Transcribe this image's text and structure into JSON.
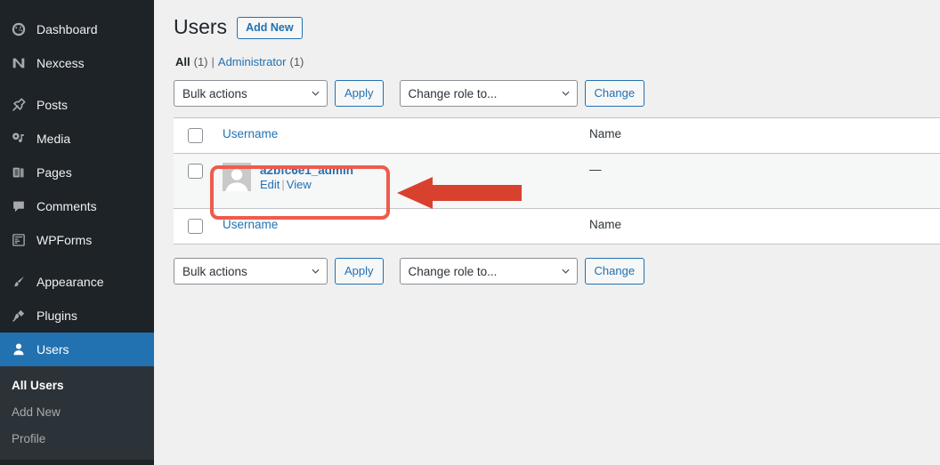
{
  "sidebar": {
    "items": [
      {
        "label": "Dashboard",
        "icon": "dashboard-icon",
        "name": "sidebar-item-dashboard",
        "active": false
      },
      {
        "label": "Nexcess",
        "icon": "nexcess-icon",
        "name": "sidebar-item-nexcess",
        "active": false
      },
      {
        "label": "Posts",
        "icon": "pushpin-icon",
        "name": "sidebar-item-posts",
        "active": false
      },
      {
        "label": "Media",
        "icon": "media-icon",
        "name": "sidebar-item-media",
        "active": false
      },
      {
        "label": "Pages",
        "icon": "pages-icon",
        "name": "sidebar-item-pages",
        "active": false
      },
      {
        "label": "Comments",
        "icon": "comment-icon",
        "name": "sidebar-item-comments",
        "active": false
      },
      {
        "label": "WPForms",
        "icon": "wpforms-icon",
        "name": "sidebar-item-wpforms",
        "active": false
      },
      {
        "label": "Appearance",
        "icon": "paintbrush-icon",
        "name": "sidebar-item-appearance",
        "active": false
      },
      {
        "label": "Plugins",
        "icon": "plug-icon",
        "name": "sidebar-item-plugins",
        "active": false
      },
      {
        "label": "Users",
        "icon": "user-icon",
        "name": "sidebar-item-users",
        "active": true
      }
    ],
    "submenu": [
      {
        "label": "All Users",
        "current": true
      },
      {
        "label": "Add New",
        "current": false
      },
      {
        "label": "Profile",
        "current": false
      }
    ],
    "active_color": "#2271b1",
    "background": "#1d2327",
    "submenu_background": "#2c3338"
  },
  "page": {
    "title": "Users",
    "add_new_label": "Add New",
    "filters": [
      {
        "label": "All",
        "count": "(1)",
        "current": true
      },
      {
        "label": "Administrator",
        "count": "(1)",
        "current": false
      }
    ],
    "filter_divider": "|"
  },
  "tablenav_top": {
    "bulk_select_value": "Bulk actions",
    "apply_label": "Apply",
    "role_select_value": "Change role to...",
    "change_label": "Change"
  },
  "tablenav_bottom": {
    "bulk_select_value": "Bulk actions",
    "apply_label": "Apply",
    "role_select_value": "Change role to...",
    "change_label": "Change"
  },
  "table": {
    "header": {
      "username": "Username",
      "name": "Name"
    },
    "footer": {
      "username": "Username",
      "name": "Name"
    },
    "rows": [
      {
        "username": "a2bfc6e1_admin",
        "edit_label": "Edit",
        "action_separator": "|",
        "view_label": "View",
        "name": "—"
      }
    ]
  },
  "annotations": {
    "highlight_box_color": "#ef5b4c",
    "arrow_color": "#d9412f",
    "arrow_direction": "left"
  }
}
